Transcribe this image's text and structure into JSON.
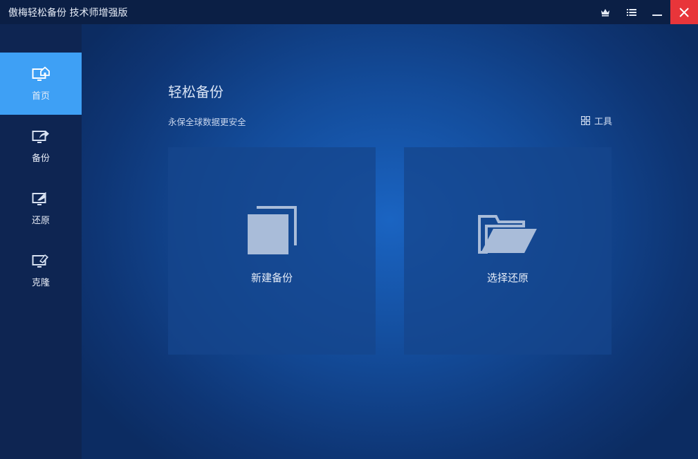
{
  "window": {
    "title": "傲梅轻松备份 技术师增强版",
    "controls": [
      "crown-icon",
      "menu-icon",
      "minimize-icon",
      "close-icon"
    ]
  },
  "sidebar": {
    "items": [
      {
        "label": "首页",
        "icon": "home-monitor-icon",
        "active": true
      },
      {
        "label": "备份",
        "icon": "backup-monitor-icon",
        "active": false
      },
      {
        "label": "还原",
        "icon": "restore-monitor-icon",
        "active": false
      },
      {
        "label": "克隆",
        "icon": "clone-monitor-icon",
        "active": false
      }
    ]
  },
  "main": {
    "title": "轻松备份",
    "subtitle": "永保全球数据更安全",
    "tools_label": "工具",
    "cards": [
      {
        "label": "新建备份",
        "icon": "new-backup-icon"
      },
      {
        "label": "选择还原",
        "icon": "folder-open-icon"
      }
    ]
  },
  "colors": {
    "titlebar": "#0b1f45",
    "sidebar": "#0e2552",
    "active": "#3ea0f5",
    "close": "#e8353a",
    "card": "#16468c"
  }
}
